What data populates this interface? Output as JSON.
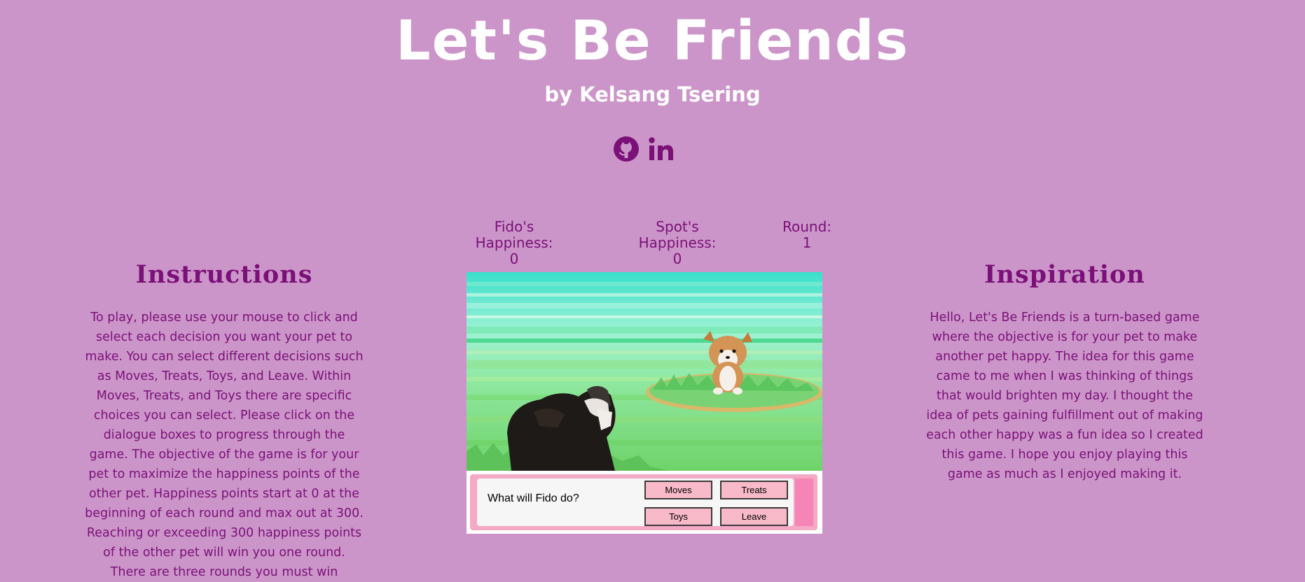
{
  "header": {
    "title": "Let's Be Friends",
    "byline": "by Kelsang Tsering"
  },
  "socials": [
    {
      "icon": "github-icon",
      "name": "GitHub"
    },
    {
      "icon": "linkedin-icon",
      "name": "LinkedIn"
    }
  ],
  "stats": {
    "fido_label": "Fido's Happiness:",
    "fido_value": "0",
    "spot_label": "Spot's Happiness:",
    "spot_value": "0",
    "round_label": "Round:",
    "round_value": "1"
  },
  "instructions": {
    "title": "Instructions",
    "body": "To play, please use your mouse to click and select each decision you want your pet to make. You can select different decisions such as Moves, Treats, Toys, and Leave. Within Moves, Treats, and Toys there are specific choices you can select. Please click on the dialogue boxes to progress through the game. The objective of the game is for your pet to maximize the happiness points of the other pet. Happiness points start at 0 at the beginning of each round and max out at 300. Reaching or exceeding 300 happiness points of the other pet will win you one round. There are three rounds you must win"
  },
  "inspiration": {
    "title": "Inspiration",
    "body": "Hello, Let's Be Friends is a turn-based game where the objective is for your pet to make another pet happy. The idea for this game came to me when I was thinking of things that would brighten my day. I thought the idea of pets gaining fulfillment out of making each other happy was a fun idea so I created this game. I hope you enjoy playing this game as much as I enjoyed making it."
  },
  "game": {
    "prompt": "What will Fido do?",
    "buttons": {
      "moves": "Moves",
      "treats": "Treats",
      "toys": "Toys",
      "leave": "Leave"
    }
  },
  "colors": {
    "background": "#cc95c9",
    "accent": "#7a1078",
    "title": "#ffffff",
    "button": "#f8b9c8"
  }
}
